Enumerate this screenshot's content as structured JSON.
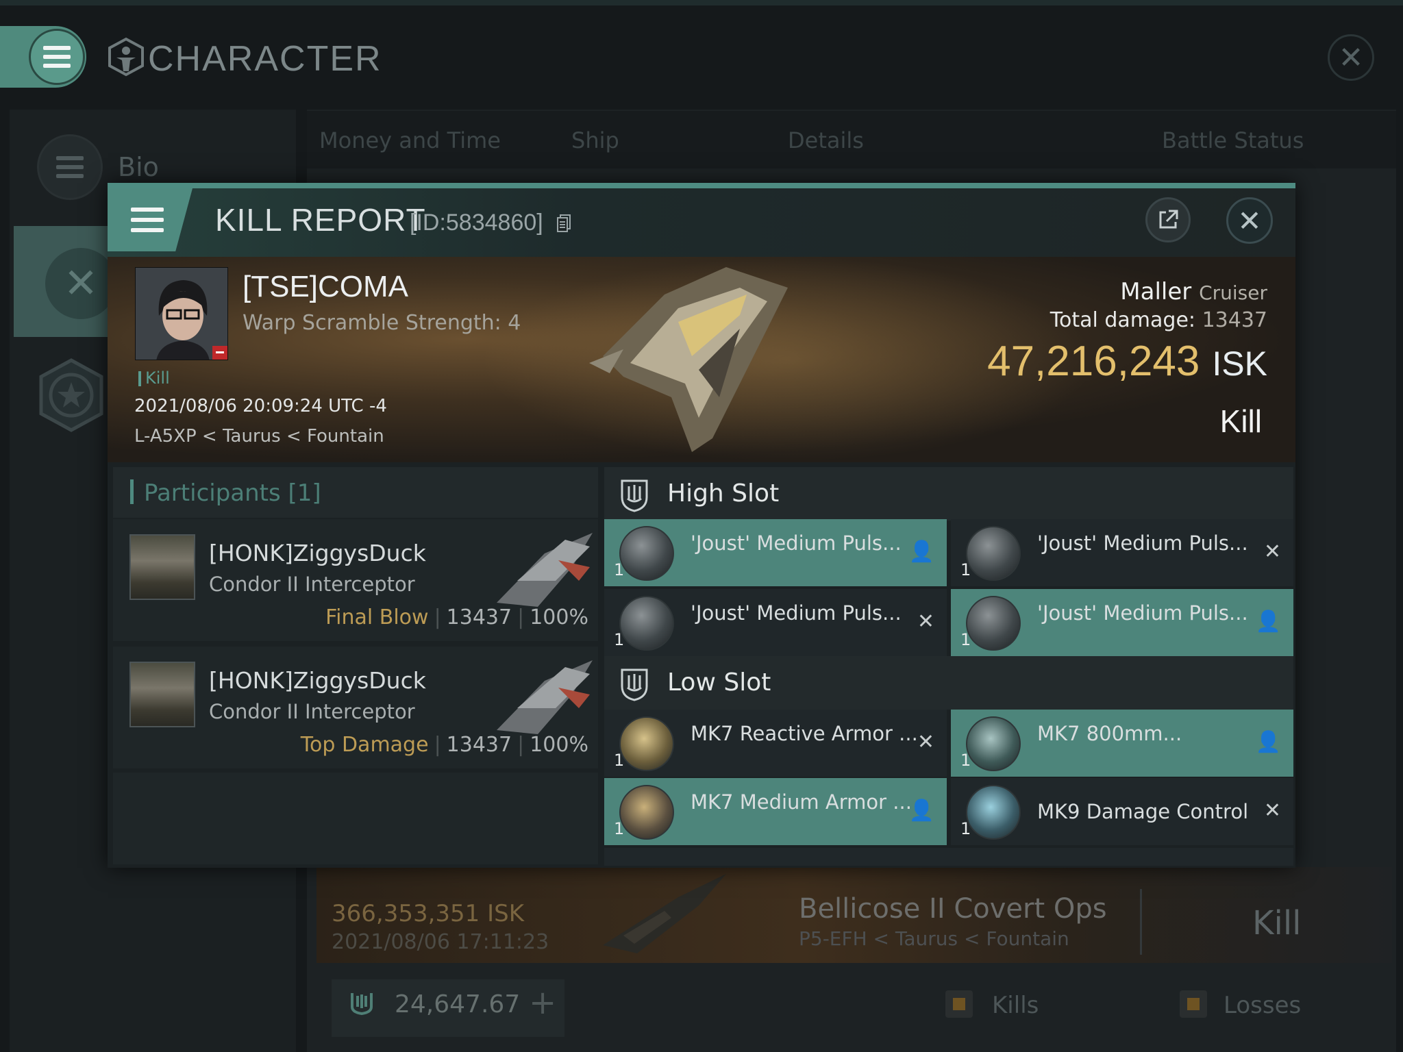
{
  "background": {
    "window_title": "CHARACTER",
    "sidebar": {
      "bio_label": "Bio"
    },
    "tabs": [
      "Money and Time",
      "Ship",
      "Details",
      "Battle Status"
    ],
    "next_card": {
      "isk": "366,353,351  ISK",
      "date": "2021/08/06  17:11:23",
      "ship": "Bellicose II Covert Ops",
      "location": "P5-EFH < Taurus < Fountain",
      "result": "Kill"
    },
    "wallet": {
      "value": "24,647.67",
      "add_label": "+"
    },
    "legend": {
      "kills": "Kills",
      "losses": "Losses"
    }
  },
  "modal": {
    "title": "KILL REPORT",
    "id_label": "[ID:5834860]",
    "victim": {
      "pilot": "[TSE]COMA",
      "warp_scramble": "Warp Scramble Strength: 4",
      "tag": "Kill",
      "time": "2021/08/06 20:09:24 UTC -4",
      "location": "L-A5XP < Taurus < Fountain"
    },
    "ship": {
      "name": "Maller",
      "class": "Cruiser",
      "total_damage_label": "Total damage:",
      "total_damage_value": "13437",
      "isk_value": "47,216,243",
      "isk_unit": "ISK",
      "result": "Kill"
    },
    "participants": {
      "title": "Participants [1]",
      "rows": [
        {
          "name": "[HONK]ZiggysDuck",
          "ship": "Condor II Interceptor",
          "role": "Final Blow",
          "damage": "13437",
          "percent": "100%"
        },
        {
          "name": "[HONK]ZiggysDuck",
          "ship": "Condor II Interceptor",
          "role": "Top Damage",
          "damage": "13437",
          "percent": "100%"
        }
      ]
    },
    "high_slot": {
      "title": "High Slot",
      "items": [
        {
          "name": "'Joust' Medium Puls...",
          "qty": "1",
          "status": "dropped"
        },
        {
          "name": "'Joust' Medium Puls...",
          "qty": "1",
          "status": "destroyed"
        },
        {
          "name": "'Joust' Medium Puls...",
          "qty": "1",
          "status": "destroyed"
        },
        {
          "name": "'Joust' Medium Puls...",
          "qty": "1",
          "status": "dropped"
        }
      ]
    },
    "low_slot": {
      "title": "Low Slot",
      "items": [
        {
          "name": "MK7 Reactive Armor ...",
          "qty": "1",
          "status": "destroyed"
        },
        {
          "name": "MK7 800mm...",
          "qty": "1",
          "status": "dropped"
        },
        {
          "name": "MK7 Medium Armor ...",
          "qty": "1",
          "status": "dropped"
        },
        {
          "name": "MK9 Damage Control",
          "qty": "1",
          "status": "destroyed"
        }
      ]
    }
  },
  "colors": {
    "accent": "#4e8a80",
    "isk_gold": "#e3bf6c",
    "role_gold": "#bd9c55",
    "dropped_bg": "#4d857b"
  },
  "icons": {
    "dropped": "person-icon",
    "destroyed": "x-icon"
  }
}
